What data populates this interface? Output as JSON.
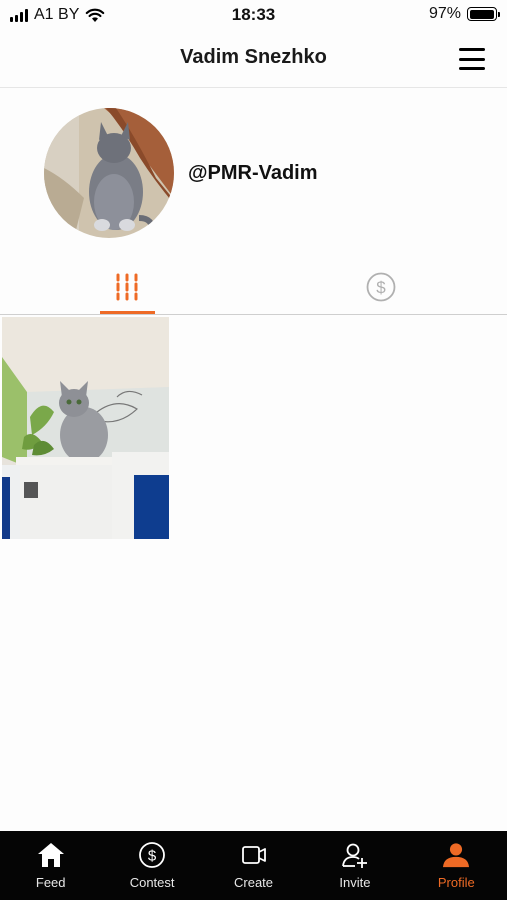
{
  "status_bar": {
    "carrier": "A1 BY",
    "time": "18:33",
    "battery": "97%",
    "battery_level": 0.97
  },
  "header": {
    "title": "Vadim Snezhko",
    "menu_icon": "hamburger-menu-icon"
  },
  "profile": {
    "handle": "@PMR-Vadim",
    "avatar": "cat-on-carpet-photo"
  },
  "tabs": [
    {
      "id": "posts",
      "icon": "grid-bars-icon",
      "active": true
    },
    {
      "id": "contest",
      "icon": "dollar-circle-icon",
      "active": false
    }
  ],
  "posts": [
    {
      "image": "cat-in-cabinet-photo"
    }
  ],
  "colors": {
    "accent": "#ee6a25",
    "nav_background": "#050505",
    "nav_text": "#e8e8e8",
    "tab_inactive": "#b0b0b0"
  },
  "bottom_nav": [
    {
      "label": "Feed",
      "icon": "home-icon",
      "active": false
    },
    {
      "label": "Contest",
      "icon": "dollar-circle-icon",
      "active": false
    },
    {
      "label": "Create",
      "icon": "video-camera-icon",
      "active": false
    },
    {
      "label": "Invite",
      "icon": "add-user-icon",
      "active": false
    },
    {
      "label": "Profile",
      "icon": "person-icon",
      "active": true
    }
  ]
}
